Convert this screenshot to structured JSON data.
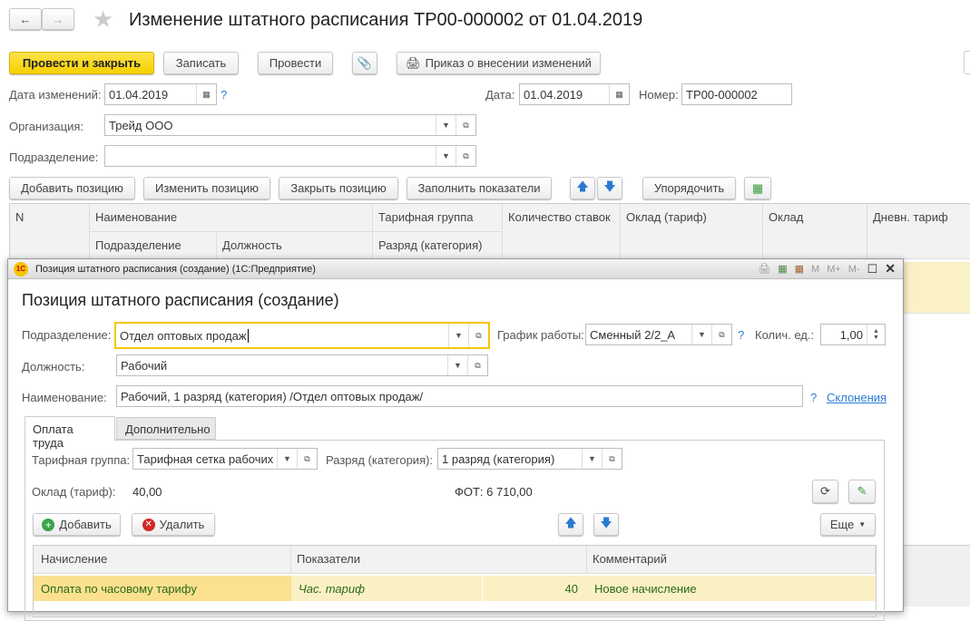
{
  "header": {
    "title": "Изменение штатного расписания ТР00-000002 от 01.04.2019"
  },
  "toolbar": {
    "post_close": "Провести и закрыть",
    "save": "Записать",
    "post": "Провести",
    "print_order": "Приказ о внесении изменений"
  },
  "fields": {
    "change_date_label": "Дата изменений:",
    "change_date": "01.04.2019",
    "date_label": "Дата:",
    "date": "01.04.2019",
    "number_label": "Номер:",
    "number": "ТР00-000002",
    "org_label": "Организация:",
    "org": "Трейд ООО",
    "dept_label": "Подразделение:",
    "dept": "",
    "help": "?"
  },
  "table_toolbar": {
    "add": "Добавить позицию",
    "edit": "Изменить позицию",
    "close": "Закрыть позицию",
    "fill": "Заполнить показатели",
    "sort": "Упорядочить"
  },
  "table": {
    "columns": [
      "N",
      "Наименование",
      "Тарифная группа",
      "Количество ставок",
      "Оклад (тариф)",
      "Оклад",
      "Дневн. тариф"
    ],
    "subcolumns": [
      "Подразделение",
      "Должность",
      "Разряд (категория)"
    ]
  },
  "dialog": {
    "window_title": "Позиция штатного расписания (создание)  (1С:Предприятие)",
    "title_buttons": [
      "M",
      "M+",
      "M-"
    ],
    "heading": "Позиция штатного расписания (создание)",
    "dept_label": "Подразделение:",
    "dept": "Отдел оптовых продаж",
    "schedule_label": "График работы:",
    "schedule": "Сменный 2/2_А",
    "units_label": "Колич. ед.:",
    "units": "1,00",
    "position_label": "Должность:",
    "position": "Рабочий",
    "name_label": "Наименование:",
    "name": "Рабочий, 1 разряд (категория) /Отдел оптовых продаж/",
    "declensions": "Склонения",
    "help": "?",
    "tabs": [
      "Оплата труда",
      "Дополнительно"
    ],
    "tariff_group_label": "Тарифная группа:",
    "tariff_group": "Тарифная сетка рабочих",
    "grade_label": "Разряд (категория):",
    "grade": "1 разряд (категория)",
    "salary_label": "Оклад (тариф):",
    "salary": "40,00",
    "fot": "ФОТ: 6 710,00",
    "add": "Добавить",
    "delete": "Удалить",
    "more": "Еще",
    "columns": [
      "Начисление",
      "Показатели",
      "Комментарий"
    ],
    "rows": [
      {
        "accrual": "Оплата по часовому тарифу",
        "indicator": "Час. тариф",
        "value": "40",
        "comment": "Новое начисление"
      }
    ]
  }
}
